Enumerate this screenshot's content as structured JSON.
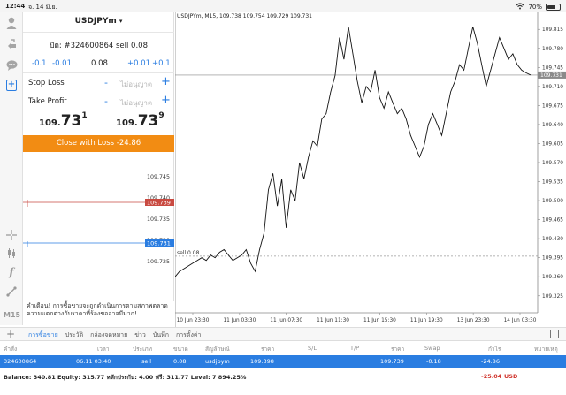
{
  "status": {
    "time": "12:44",
    "date": "จ. 14 มิ.ย.",
    "battery": "70%"
  },
  "order": {
    "symbol": "USDJPYm",
    "caret": "▾",
    "ticket_line": "ปิด: #324600864 sell 0.08",
    "steps": [
      "-0.1",
      "-0.01",
      "0.08",
      "+0.01",
      "+0.1"
    ],
    "stop_loss_label": "Stop Loss",
    "take_profit_label": "Take Profit",
    "minus": "-",
    "plus": "+",
    "not_set": "ไม่อนุญาต",
    "bid_small": "109.",
    "bid_big": "73",
    "bid_sup": "1",
    "ask_small": "109.",
    "ask_big": "73",
    "ask_sup": "9",
    "close_button": "Close with Loss -24.86"
  },
  "mini_chart": {
    "ticks": [
      "109.745",
      "109.740",
      "109.735",
      "109.730",
      "109.725"
    ],
    "red_label": "109.739",
    "blue_label": "109.731"
  },
  "warning": "คำเตือน! การซื้อขายจะถูกดำเนินการตามสภาพตลาด ความแตกต่างกับราคาที่ร้องขออาจมีมาก!",
  "left_tools": {
    "timeframe": "M15"
  },
  "chart_data": {
    "type": "line",
    "header": "USDJPYm, M15, 109.738 109.754 109.729 109.731",
    "y_ticks": [
      "109.815",
      "109.780",
      "109.745",
      "109.710",
      "109.675",
      "109.640",
      "109.605",
      "109.570",
      "109.535",
      "109.500",
      "109.465",
      "109.430",
      "109.395",
      "109.360",
      "109.325"
    ],
    "x_ticks": [
      "10 Jun 23:30",
      "11 Jun 03:30",
      "11 Jun 07:30",
      "11 Jun 11:30",
      "11 Jun 15:30",
      "11 Jun 19:30",
      "13 Jun 23:30",
      "14 Jun 03:30"
    ],
    "ylim": [
      109.31,
      109.83
    ],
    "current_price": "109.731",
    "current_value": 109.731,
    "order_label": "sell 0.08",
    "order_value": 109.398,
    "values": [
      109.36,
      109.37,
      109.375,
      109.38,
      109.385,
      109.39,
      109.395,
      109.39,
      109.4,
      109.395,
      109.405,
      109.41,
      109.4,
      109.39,
      109.395,
      109.4,
      109.41,
      109.385,
      109.37,
      109.41,
      109.44,
      109.52,
      109.55,
      109.49,
      109.54,
      109.45,
      109.52,
      109.5,
      109.57,
      109.54,
      109.58,
      109.61,
      109.6,
      109.65,
      109.66,
      109.7,
      109.73,
      109.8,
      109.76,
      109.82,
      109.77,
      109.72,
      109.68,
      109.71,
      109.7,
      109.74,
      109.69,
      109.67,
      109.7,
      109.68,
      109.66,
      109.67,
      109.65,
      109.62,
      109.6,
      109.58,
      109.6,
      109.64,
      109.66,
      109.64,
      109.62,
      109.66,
      109.7,
      109.72,
      109.75,
      109.74,
      109.78,
      109.82,
      109.79,
      109.75,
      109.71,
      109.74,
      109.77,
      109.8,
      109.78,
      109.76,
      109.77,
      109.75,
      109.74,
      109.735,
      109.731
    ]
  },
  "bottom": {
    "tabs": [
      "การซื้อขาย",
      "ประวัติ",
      "กล่องจดหมาย",
      "ข่าว",
      "บันทึก",
      "การตั้งค่า"
    ]
  },
  "table": {
    "headers": [
      "คำสั่ง",
      "เวลา",
      "ประเภท",
      "ขนาด",
      "สัญลักษณ์",
      "ราคา",
      "S/L",
      "T/P",
      "ราคา",
      "Swap",
      "กำไร",
      "หมายเหตุ"
    ],
    "row": [
      "324600864",
      "06.11 03:40",
      "sell",
      "0.08",
      "usdjpym",
      "109.398",
      "",
      "",
      "109.739",
      "-0.18",
      "-24.86",
      ""
    ]
  },
  "balance": {
    "text": "Balance: 340.81  Equity: 315.77  หลักประกัน: 4.00  ฟรี: 311.77  Level: 7 894.25%",
    "profit": "-25.04",
    "currency": "USD"
  }
}
